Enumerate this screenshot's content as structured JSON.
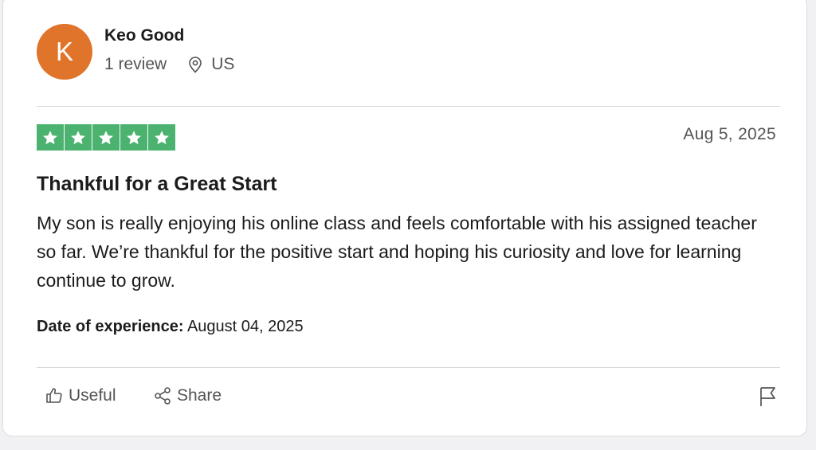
{
  "reviewer": {
    "avatar_initial": "K",
    "name": "Keo Good",
    "review_count": "1 review",
    "country": "US"
  },
  "rating": {
    "stars": 5,
    "max": 5,
    "color": "#4cb26f"
  },
  "review": {
    "date": "Aug 5, 2025",
    "title": "Thankful for a Great Start",
    "body": "My son is really enjoying his online class and feels comfortable with his assigned teacher so far. We’re thankful for the positive start and hoping his curiosity and love for learning continue to grow.",
    "experience_label": "Date of experience:",
    "experience_date": "August 04, 2025"
  },
  "actions": {
    "useful_label": "Useful",
    "share_label": "Share"
  },
  "colors": {
    "avatar_bg": "#e0742a",
    "star_green": "#4cb26f",
    "muted_text": "#545454"
  },
  "icons": [
    "location-pin-icon",
    "star-icon",
    "thumbs-up-icon",
    "share-icon",
    "flag-icon"
  ]
}
